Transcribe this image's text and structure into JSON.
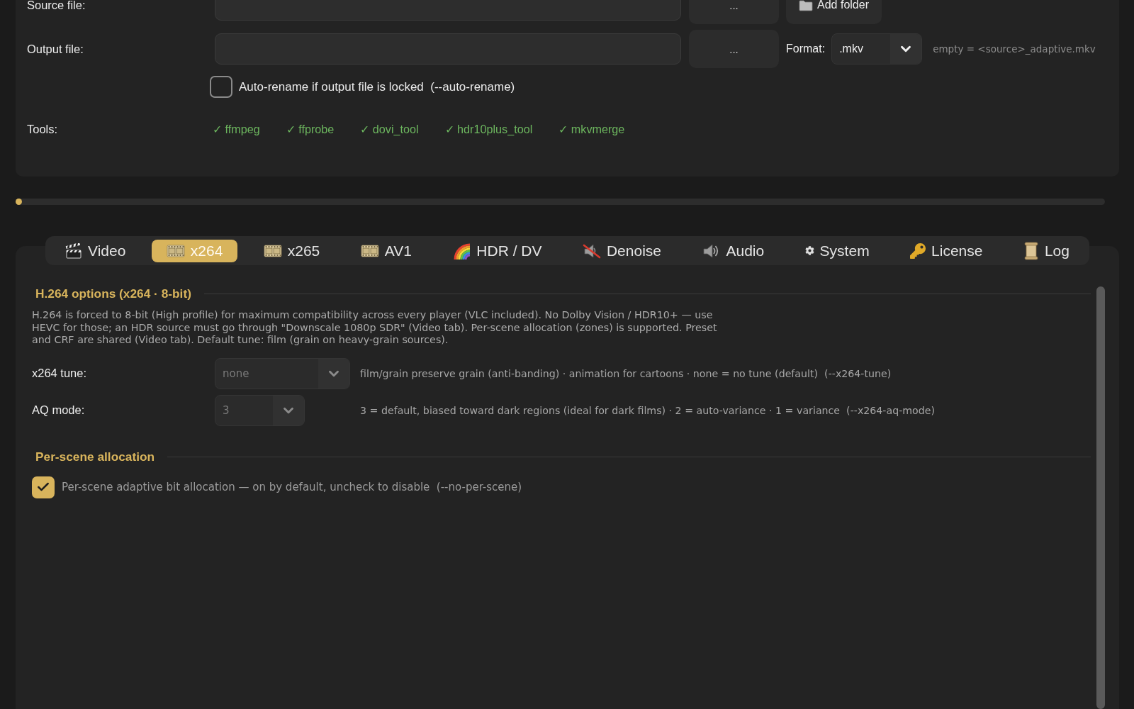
{
  "file_panel": {
    "source": {
      "label": "Source file:",
      "browse_button": "...",
      "add_folder_button": "Add folder"
    },
    "output": {
      "label": "Output file:",
      "browse_button": "...",
      "format_label": "Format:",
      "format_value": ".mkv",
      "hint": "empty = <source>_adaptive.mkv"
    },
    "auto_rename": {
      "label": "Auto-rename if output file is locked  (--auto-rename)",
      "checked": false
    },
    "tools": {
      "label": "Tools:",
      "items": [
        "✓ ffmpeg",
        "✓ ffprobe",
        "✓ dovi_tool",
        "✓ hdr10plus_tool",
        "✓ mkvmerge"
      ]
    }
  },
  "progress": {
    "level": 0
  },
  "tabs": [
    {
      "label": "Video",
      "selected": false
    },
    {
      "label": "x264",
      "selected": true
    },
    {
      "label": "x265",
      "selected": false
    },
    {
      "label": "AV1",
      "selected": false
    },
    {
      "label": "HDR / DV",
      "selected": false
    },
    {
      "label": "Denoise",
      "selected": false
    },
    {
      "label": "Audio",
      "selected": false
    },
    {
      "label": "System",
      "selected": false
    },
    {
      "label": "License",
      "selected": false
    },
    {
      "label": "Log",
      "selected": false
    }
  ],
  "x264_options": {
    "title": "H.264 options (x264 · 8-bit)",
    "description": "H.264 is forced to 8-bit (High profile) for maximum compatibility across every player (VLC included). No Dolby Vision / HDR10+ — use HEVC for those; an HDR source must go through \"Downscale 1080p SDR\" (Video tab). Per-scene allocation (zones) is supported. Preset and CRF are shared (Video tab). Default tune: film (grain on heavy-grain sources).",
    "fields": [
      {
        "label": "x264 tune:",
        "value": "none",
        "disabled": true,
        "hint": "film/grain preserve grain (anti-banding) · animation for cartoons · none = no tune (default)  (--x264-tune)"
      },
      {
        "label": "AQ mode:",
        "value": "3",
        "disabled": true,
        "hint": "3 = default, biased toward dark regions (ideal for dark films) · 2 = auto-variance · 1 = variance  (--x264-aq-mode)"
      }
    ]
  },
  "per_scene": {
    "title": "Per-scene allocation",
    "checkbox": {
      "label": "Per-scene adaptive bit allocation — on by default, uncheck to disable  (--no-per-scene)",
      "checked": true
    }
  }
}
